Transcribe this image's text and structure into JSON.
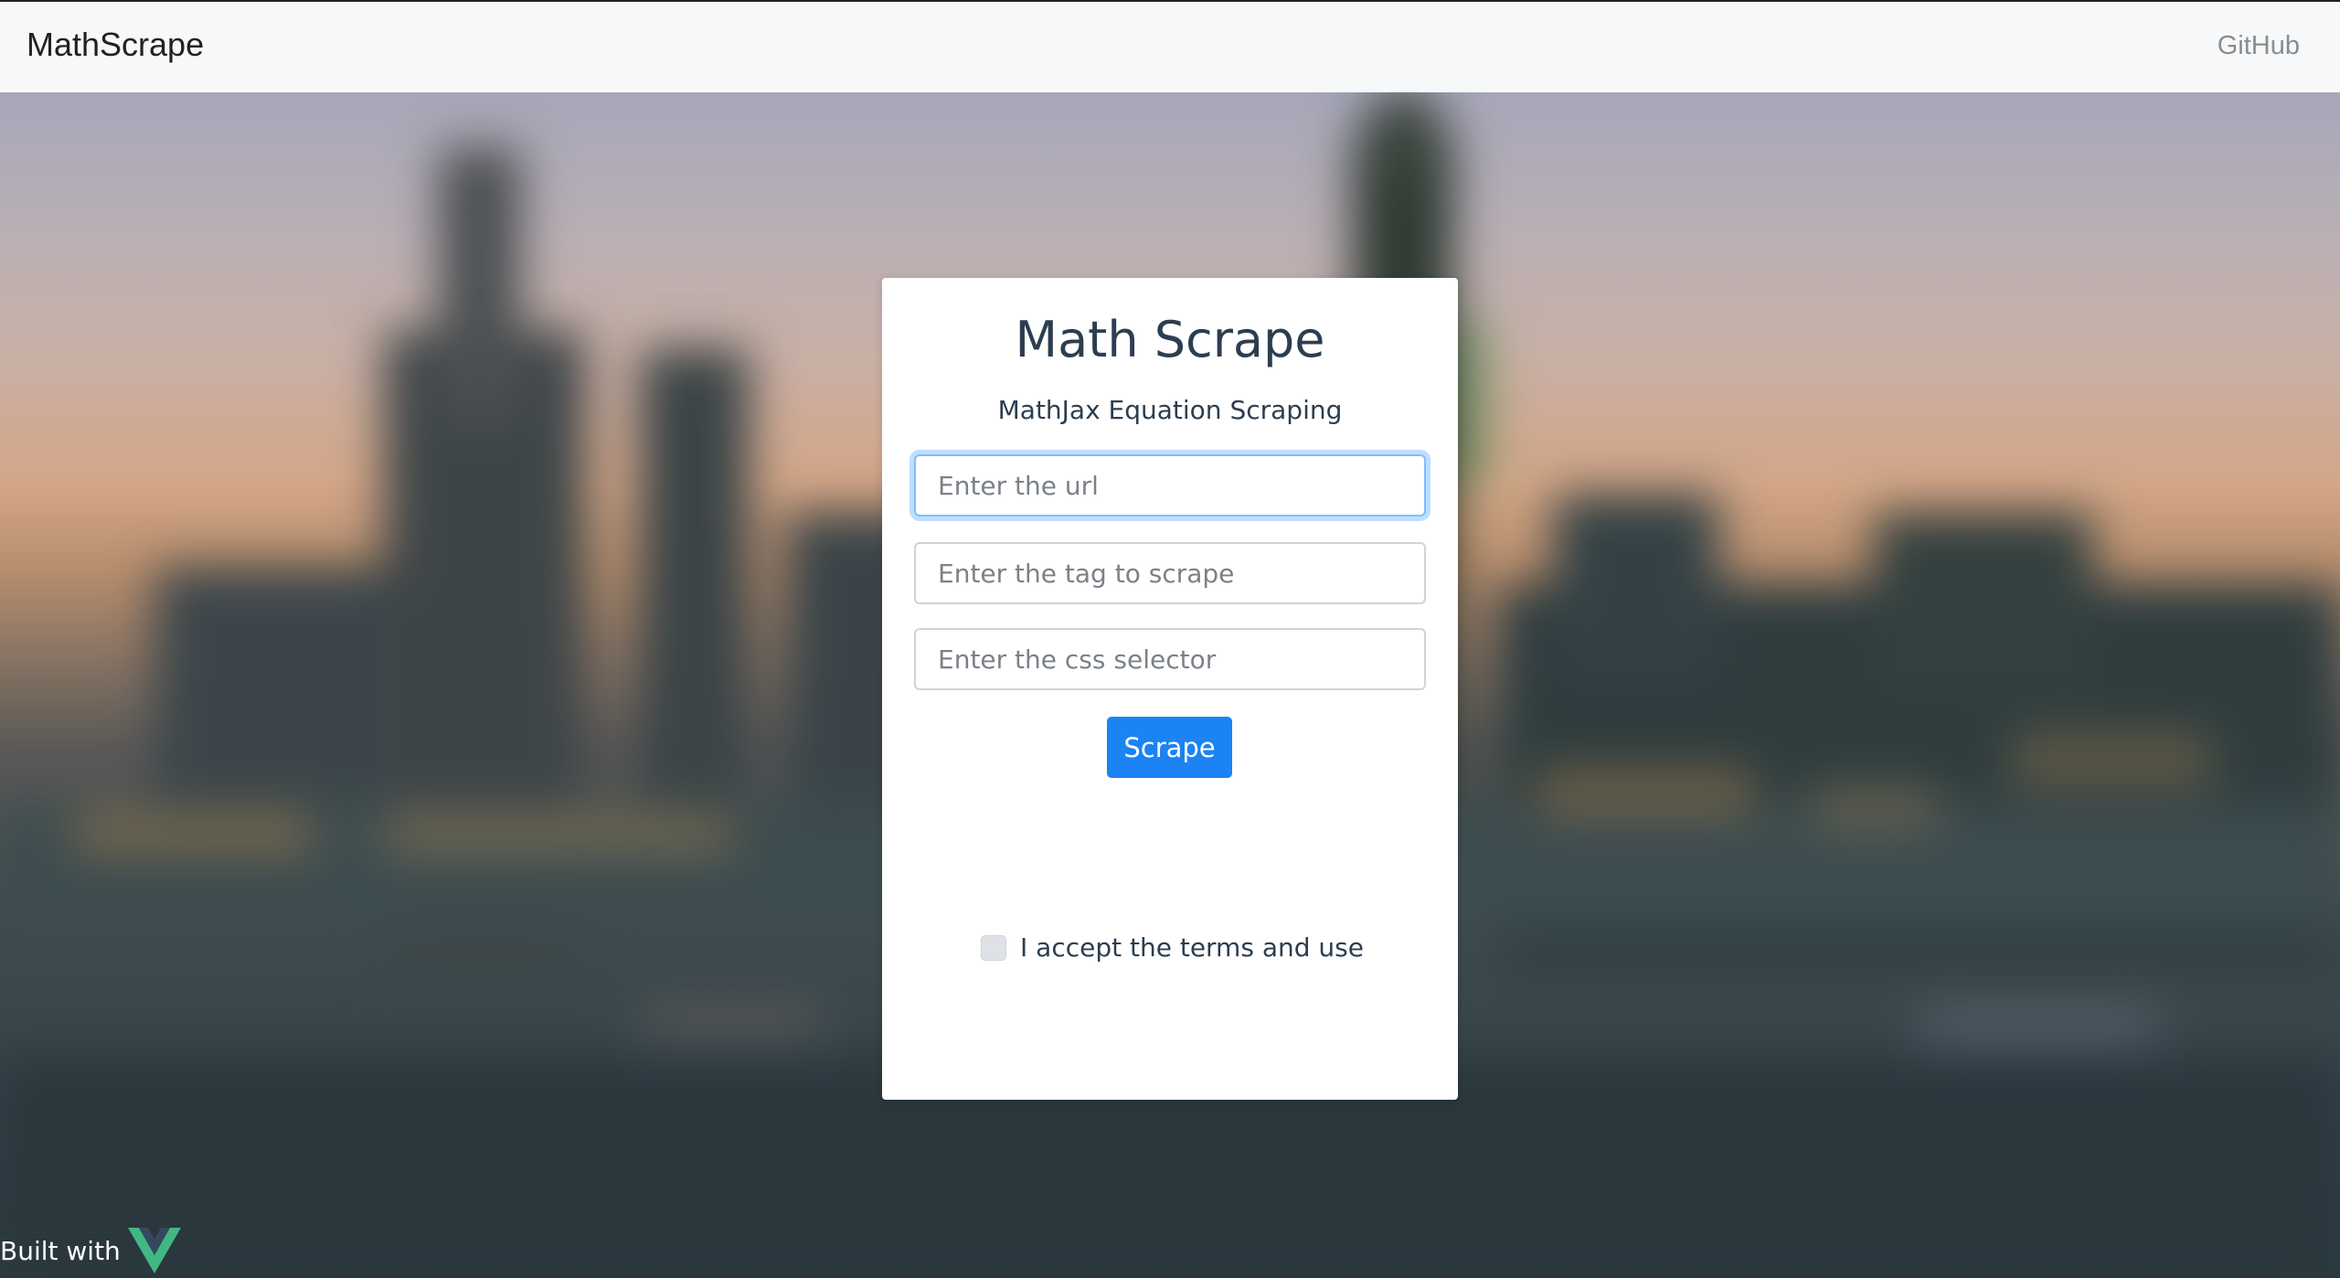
{
  "navbar": {
    "brand": "MathScrape",
    "github_link": "GitHub"
  },
  "card": {
    "title": "Math Scrape",
    "subtitle": "MathJax Equation Scraping",
    "url_placeholder": "Enter the url",
    "tag_placeholder": "Enter the tag to scrape",
    "selector_placeholder": "Enter the css selector",
    "scrape_button": "Scrape",
    "terms_label": "I accept the terms and use",
    "terms_checked": false
  },
  "footer": {
    "text": "Built with",
    "logo_icon": "vue-logo-icon"
  },
  "colors": {
    "primary": "#1b83f4",
    "title_text": "#2c3e50",
    "vue_green": "#41b883",
    "vue_dark": "#35495e"
  }
}
